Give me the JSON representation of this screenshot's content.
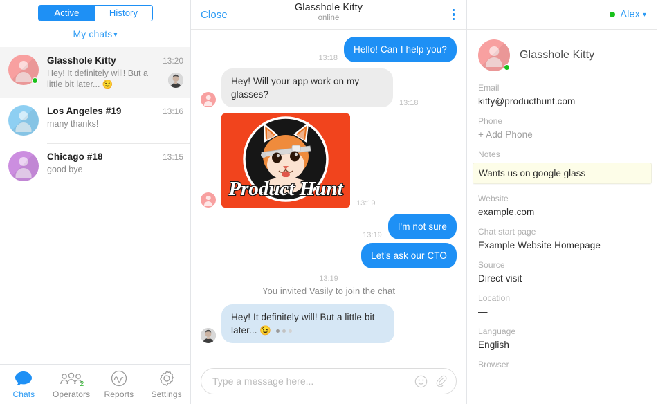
{
  "sidebar": {
    "tabs": [
      {
        "label": "Active",
        "active": true
      },
      {
        "label": "History",
        "active": false
      }
    ],
    "filter_label": "My chats",
    "chats": [
      {
        "name": "Glasshole Kitty",
        "time": "13:20",
        "snippet": "Hey! It definitely will! But a little bit later... 😉",
        "avatar_color": "#f8a0a0",
        "online": true,
        "selected": true,
        "has_operator_avatar": true
      },
      {
        "name": "Los Angeles #19",
        "time": "13:16",
        "snippet": "many thanks!",
        "avatar_color": "#8ecff2",
        "online": false,
        "selected": false,
        "has_operator_avatar": false
      },
      {
        "name": "Chicago #18",
        "time": "13:15",
        "snippet": "good bye",
        "avatar_color": "#cc8ee0",
        "online": false,
        "selected": false,
        "has_operator_avatar": false
      }
    ],
    "nav": [
      {
        "label": "Chats",
        "icon": "chat-bubble-icon",
        "active": true,
        "badge": ""
      },
      {
        "label": "Operators",
        "icon": "operators-icon",
        "active": false,
        "badge": "2"
      },
      {
        "label": "Reports",
        "icon": "reports-icon",
        "active": false,
        "badge": ""
      },
      {
        "label": "Settings",
        "icon": "gear-icon",
        "active": false,
        "badge": ""
      }
    ]
  },
  "conversation": {
    "close_label": "Close",
    "title": "Glasshole Kitty",
    "subtitle": "online",
    "menu_icon": "kebab-menu-icon",
    "messages": [
      {
        "type": "text",
        "direction": "out",
        "time": "13:18",
        "text": "Hello! Can I help you?"
      },
      {
        "type": "text",
        "direction": "in",
        "time": "13:18",
        "text": "Hey! Will your app work on my glasses?",
        "avatar": "visitor"
      },
      {
        "type": "image",
        "direction": "in",
        "time": "13:19",
        "alt": "Product Hunt cat wearing google glass",
        "caption": "Product Hunt",
        "avatar": "visitor"
      },
      {
        "type": "text",
        "direction": "out",
        "time": "13:19",
        "text": "I'm not sure"
      },
      {
        "type": "text",
        "direction": "out",
        "time": "",
        "text": "Let's ask our CTO"
      },
      {
        "type": "system",
        "time": "13:19",
        "text": "You invited Vasily to join the chat"
      },
      {
        "type": "text",
        "direction": "in",
        "time": "",
        "text": "Hey! It definitely will! But a little bit later... 😉",
        "avatar": "operator",
        "style": "blue",
        "dots": true
      }
    ],
    "composer": {
      "placeholder": "Type a message here...",
      "value": "",
      "emoji_icon": "smiley-icon",
      "attach_icon": "paperclip-icon"
    }
  },
  "right_panel": {
    "operator": {
      "name": "Alex",
      "status": "online",
      "status_color": "#19c11b"
    },
    "profile": {
      "name": "Glasshole Kitty",
      "avatar_color": "#f8a0a0",
      "online": true
    },
    "fields": [
      {
        "label": "Email",
        "value": "kitty@producthunt.com",
        "kind": "text"
      },
      {
        "label": "Phone",
        "value": "+ Add Phone",
        "kind": "muted"
      },
      {
        "label": "Notes",
        "value": "Wants us on google glass",
        "kind": "note"
      },
      {
        "label": "Website",
        "value": "example.com",
        "kind": "text"
      },
      {
        "label": "Chat start page",
        "value": "Example Website Homepage",
        "kind": "text"
      },
      {
        "label": "Source",
        "value": "Direct visit",
        "kind": "text"
      },
      {
        "label": "Location",
        "value": "—",
        "kind": "text"
      },
      {
        "label": "Language",
        "value": "English",
        "kind": "text"
      },
      {
        "label": "Browser",
        "value": "",
        "kind": "text"
      }
    ]
  },
  "colors": {
    "accent": "#1e90f5",
    "link": "#2f9cf4",
    "online": "#19c11b",
    "bubble_out": "#1e90f5",
    "bubble_in": "#ececec",
    "bubble_in_blue": "#d6e7f5",
    "note_bg": "#fdfde8",
    "producthunt_orange": "#f1441d"
  }
}
